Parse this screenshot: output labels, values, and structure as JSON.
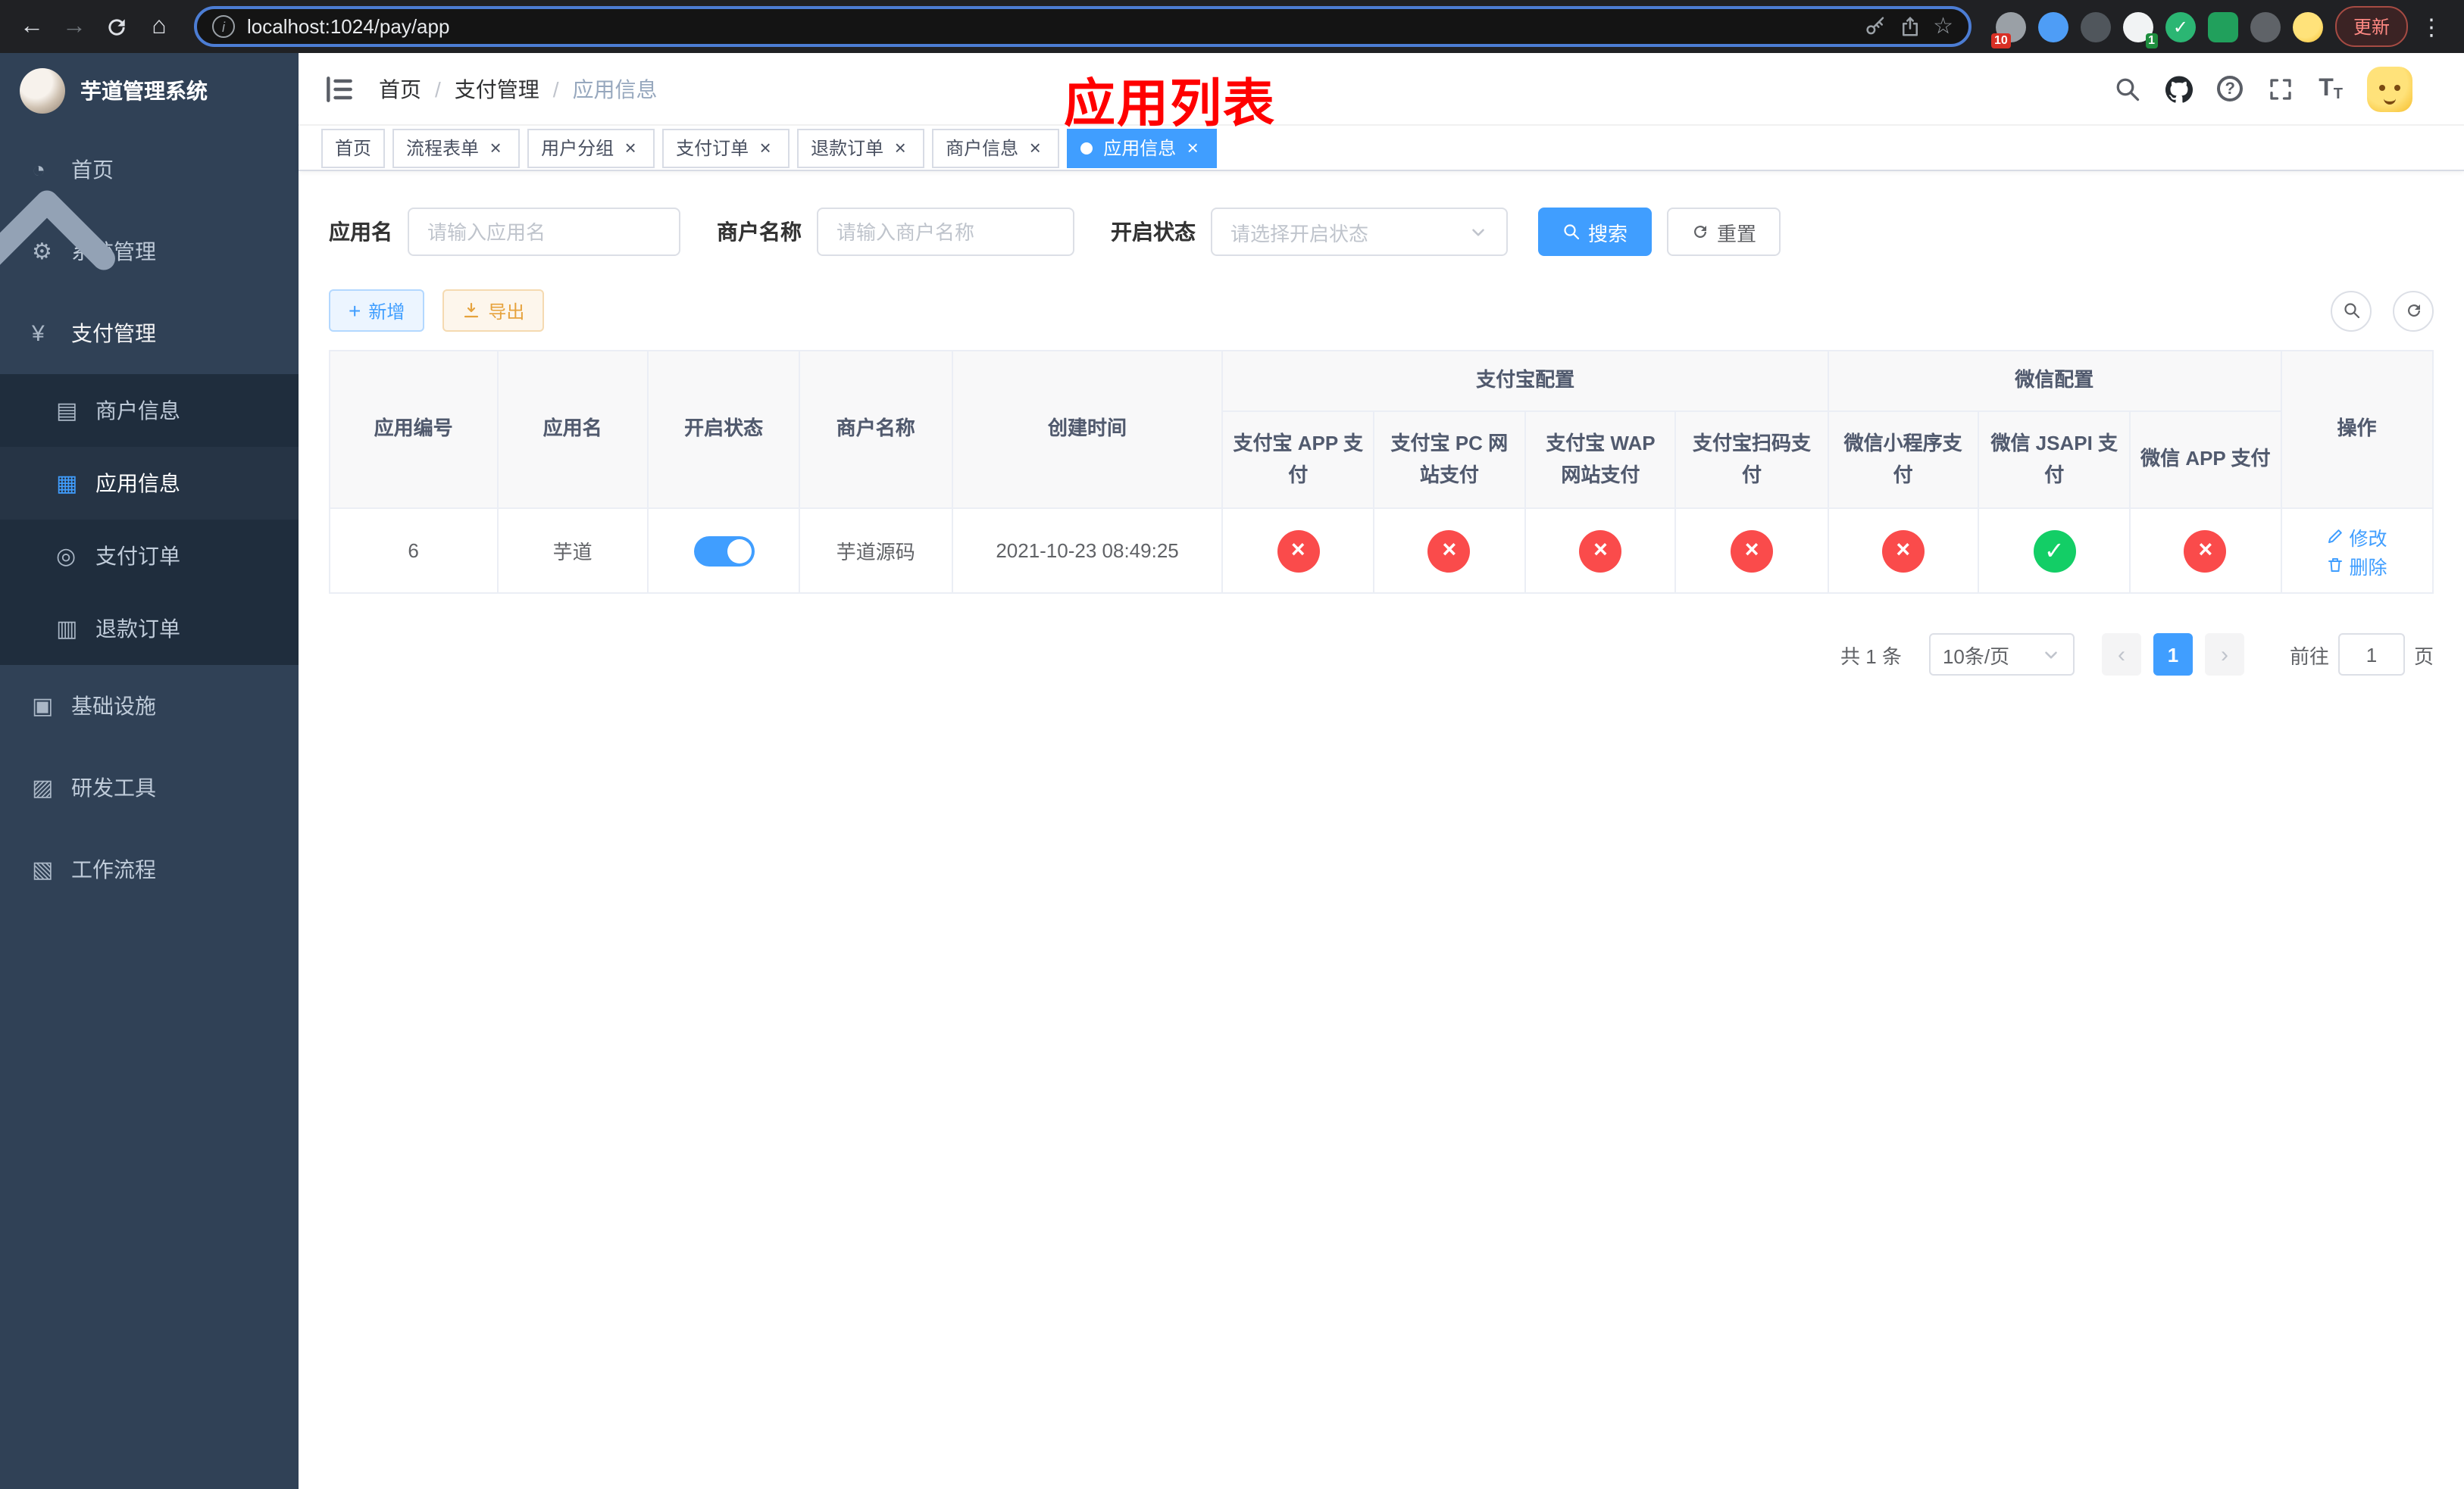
{
  "colors": {
    "primary": "#409eff",
    "success": "#13ce66",
    "danger": "#fa4b4b",
    "warning": "#e6a23c",
    "sidebar_bg": "#304156",
    "sidebar_submenu_bg": "#1f2d3d",
    "annotation": "#ff0000"
  },
  "icons": {
    "back": "←",
    "forward": "→",
    "home": "⌂",
    "star": "☆",
    "menu_dots": "⋮",
    "info": "i",
    "question": "?",
    "font_large": "T",
    "font_small": "T",
    "check": "✓",
    "cross": "×",
    "plus": "+",
    "dashboard": "◔",
    "gear": "⚙",
    "yen": "¥",
    "merchant": "▤",
    "app_grid": "▦",
    "pay_order": "◎",
    "refund": "▥",
    "infra": "▣",
    "devtools": "▨",
    "workflow": "▧"
  },
  "browser": {
    "url": "localhost:1024/pay/app",
    "update_button": "更新",
    "ext_badge_blocker": "10",
    "ext_badge_translate": "1"
  },
  "annotation": {
    "title": "应用列表"
  },
  "sidebar": {
    "app_title": "芋道管理系统",
    "menu": [
      {
        "label": "首页"
      },
      {
        "label": "系统管理"
      },
      {
        "label": "支付管理"
      },
      {
        "label": "基础设施"
      },
      {
        "label": "研发工具"
      },
      {
        "label": "工作流程"
      }
    ],
    "payment_submenu": [
      {
        "label": "商户信息"
      },
      {
        "label": "应用信息"
      },
      {
        "label": "支付订单"
      },
      {
        "label": "退款订单"
      }
    ]
  },
  "topbar": {
    "breadcrumb": [
      {
        "label": "首页"
      },
      {
        "label": "支付管理"
      },
      {
        "label": "应用信息"
      }
    ]
  },
  "tabs": [
    {
      "label": "首页"
    },
    {
      "label": "流程表单"
    },
    {
      "label": "用户分组"
    },
    {
      "label": "支付订单"
    },
    {
      "label": "退款订单"
    },
    {
      "label": "商户信息"
    },
    {
      "label": "应用信息"
    }
  ],
  "filters": {
    "app_name_label": "应用名",
    "app_name_placeholder": "请输入应用名",
    "merchant_label": "商户名称",
    "merchant_placeholder": "请输入商户名称",
    "status_label": "开启状态",
    "status_placeholder": "请选择开启状态",
    "search_button": "搜索",
    "reset_button": "重置"
  },
  "toolbar": {
    "add_button": "新增",
    "export_button": "导出"
  },
  "table": {
    "group_headers": {
      "alipay": "支付宝配置",
      "wechat": "微信配置"
    },
    "columns": [
      "应用编号",
      "应用名",
      "开启状态",
      "商户名称",
      "创建时间",
      "支付宝 APP 支付",
      "支付宝 PC 网站支付",
      "支付宝 WAP 网站支付",
      "支付宝扫码支付",
      "微信小程序支付",
      "微信 JSAPI 支付",
      "微信 APP 支付",
      "操作"
    ],
    "rows": [
      {
        "id": "6",
        "name": "芋道",
        "status": "on",
        "merchant": "芋道源码",
        "created": "2021-10-23 08:49:25",
        "alipay_app": "disabled",
        "alipay_pc": "disabled",
        "alipay_wap": "disabled",
        "alipay_scan": "disabled",
        "wechat_mini": "disabled",
        "wechat_jsapi": "enabled",
        "wechat_app": "disabled",
        "edit_label": "修改",
        "delete_label": "删除"
      }
    ]
  },
  "pagination": {
    "total_text": "共 1 条",
    "page_size": "10条/页",
    "current_page": "1",
    "goto_prefix": "前往",
    "goto_value": "1",
    "goto_suffix": "页"
  }
}
